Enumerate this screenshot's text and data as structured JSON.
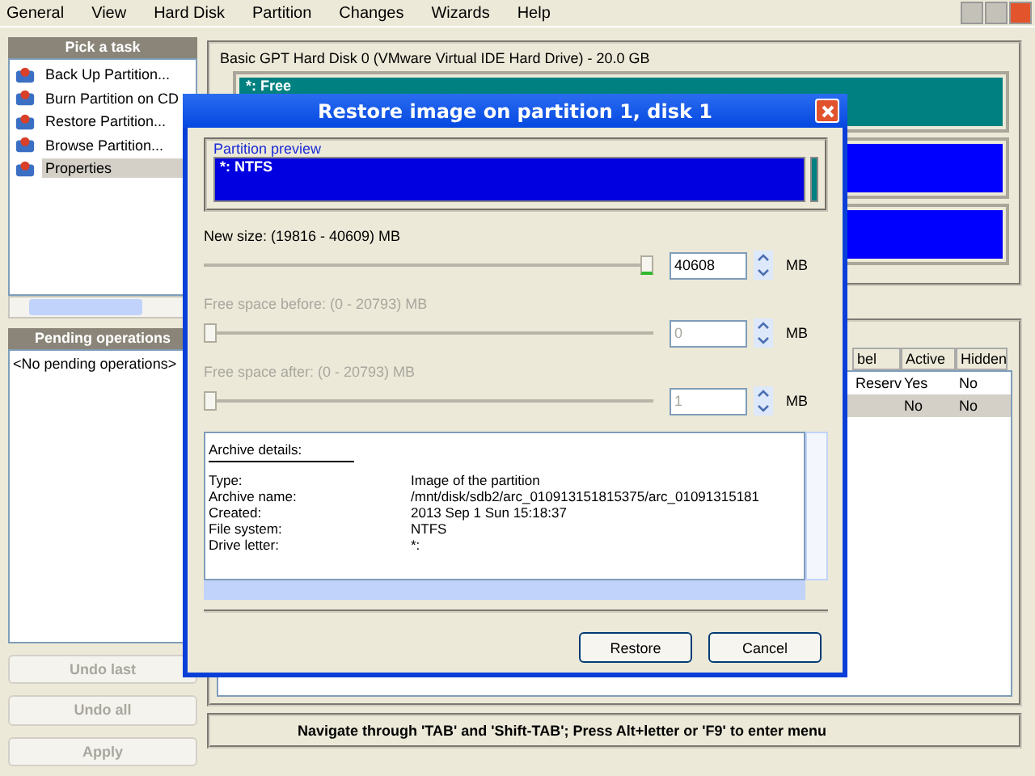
{
  "menu": [
    "General",
    "View",
    "Hard Disk",
    "Partition",
    "Changes",
    "Wizards",
    "Help"
  ],
  "task_panel": {
    "title": "Pick a task",
    "items": [
      {
        "label": "Back Up Partition...",
        "selected": false
      },
      {
        "label": "Burn Partition on CD",
        "selected": false
      },
      {
        "label": "Restore Partition...",
        "selected": false
      },
      {
        "label": "Browse Partition...",
        "selected": false
      },
      {
        "label": "Properties",
        "selected": true
      }
    ]
  },
  "pending_panel": {
    "title": "Pending operations",
    "items": [
      "<No pending operations>"
    ]
  },
  "action_buttons": [
    {
      "label": "Undo last",
      "disabled": true
    },
    {
      "label": "Undo all",
      "disabled": true
    },
    {
      "label": "Apply",
      "disabled": true
    }
  ],
  "disk": {
    "title": "Basic GPT Hard Disk 0 (VMware Virtual IDE Hard Drive) - 20.0 GB",
    "partitions": [
      {
        "label": "*: Free",
        "color": "#008080"
      },
      {
        "color": "#0000ff"
      },
      {
        "color": "#0000ff"
      }
    ]
  },
  "table": {
    "columns": [
      "bel",
      "Active",
      "Hidden"
    ],
    "rows": [
      {
        "label": "Reserv",
        "active": "Yes",
        "hidden": "No",
        "selected": false
      },
      {
        "active": "No",
        "hidden": "No",
        "selected": true
      }
    ]
  },
  "status_bar": "Navigate through 'TAB' and 'Shift-TAB'; Press Alt+letter or 'F9' to enter menu",
  "dialog": {
    "title": "Restore image on partition 1, disk 1",
    "preview": {
      "title": "Partition preview",
      "label": "*: NTFS"
    },
    "sliders": [
      {
        "label": "New size: (19816 - 40609) MB",
        "level": 1.0,
        "value": "40608",
        "unit": "MB",
        "disabled": false
      },
      {
        "label": "Free space before: (0 - 20793) MB",
        "level": 0,
        "value": "0",
        "unit": "MB",
        "disabled": true
      },
      {
        "label": "Free space after: (0 - 20793) MB",
        "level": 0,
        "value": "1",
        "unit": "MB",
        "disabled": true
      }
    ],
    "details": {
      "heading": "Archive details:",
      "rows": [
        {
          "key": "Type:",
          "value": "Image of the partition"
        },
        {
          "key": "Archive name:",
          "value": "/mnt/disk/sdb2/arc_010913151815375/arc_01091315181"
        },
        {
          "key": "Created:",
          "value": "2013 Sep 1 Sun 15:18:37"
        },
        {
          "key": "File system:",
          "value": "NTFS"
        },
        {
          "key": "Drive letter:",
          "value": "*:"
        }
      ]
    },
    "buttons": [
      "Restore",
      "Cancel"
    ]
  }
}
